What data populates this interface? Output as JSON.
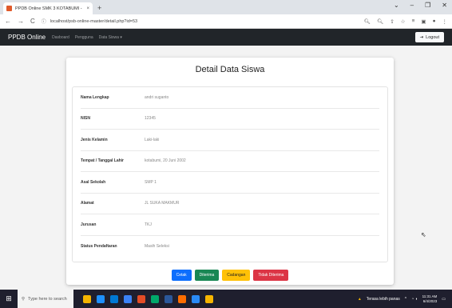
{
  "browser": {
    "tab_title": "PPDB Online SMK 3 KOTABUMI -",
    "tab_close": "×",
    "new_tab": "+",
    "window_controls": [
      "⌄",
      "–",
      "❐",
      "✕"
    ],
    "url": "localhost/psb-online-master/detail.php?id=53",
    "nav": [
      "←",
      "→",
      "C"
    ]
  },
  "navbar": {
    "brand": "PPDB Online",
    "links": [
      "Dasboard",
      "Pengguna",
      "Data Siswa ▾"
    ],
    "logout": "Logout"
  },
  "card": {
    "title": "Detail Data Siswa",
    "rows": [
      {
        "label": "Nama Lengkap",
        "value": "andri suganto"
      },
      {
        "label": "NISN",
        "value": "12345"
      },
      {
        "label": "Jenis Kelamin",
        "value": "Laki-laki"
      },
      {
        "label": "Tempat / Tanggal Lahir",
        "value": "kotabumi, 20 Juni 2002"
      },
      {
        "label": "Asal Sekolah",
        "value": "SMP 1"
      },
      {
        "label": "Alamat",
        "value": "JL SUKA MAKMUR"
      },
      {
        "label": "Jurusan",
        "value": "TKJ"
      },
      {
        "label": "Status Pendaftaran",
        "value": "Masih Seleksi"
      }
    ],
    "actions": {
      "cetak": "Cetak",
      "diterima": "Diterima",
      "cadangan": "Cadangan",
      "tidak_diterima": "Tidak Diterima"
    }
  },
  "taskbar": {
    "search_placeholder": "Type here to search",
    "weather": "Terasa lebih panas",
    "time": "11:31 AM",
    "date": "6/4/2023",
    "app_colors": [
      "#f4b400",
      "#1e90ff",
      "#0078d4",
      "#3b82f6",
      "#e34c26",
      "#00a86b",
      "#2b579a",
      "#ff6d00",
      "#2a8af6",
      "#f7b500"
    ]
  },
  "colors": {
    "navbar_bg": "#212529",
    "primary": "#0d6efd",
    "success": "#198754",
    "warning": "#ffc107",
    "danger": "#dc3545"
  }
}
